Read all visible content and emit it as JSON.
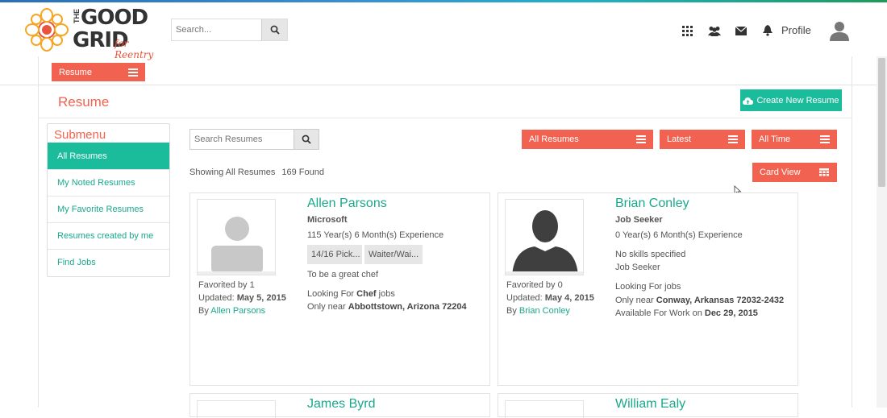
{
  "header": {
    "logo": {
      "line1": "GOOD",
      "line2": "GRID",
      "top_word": "THE",
      "sub": "for Reentry"
    },
    "search": {
      "placeholder": "Search..."
    },
    "nav_icons": [
      "apps-grid-icon",
      "users-icon",
      "envelope-icon",
      "bell-icon"
    ],
    "profile_label": "Profile"
  },
  "toolbar": {
    "resume_tab_label": "Resume"
  },
  "page": {
    "title": "Resume",
    "create_button_label": "Create New Resume"
  },
  "submenu": {
    "title": "Submenu",
    "items": [
      {
        "label": "All Resumes",
        "active": true
      },
      {
        "label": "My Noted Resumes",
        "active": false
      },
      {
        "label": "My Favorite Resumes",
        "active": false
      },
      {
        "label": "Resumes created by me",
        "active": false
      },
      {
        "label": "Find Jobs",
        "active": false
      }
    ]
  },
  "resumes_search": {
    "placeholder": "Search Resumes"
  },
  "filters": {
    "all": "All Resumes",
    "latest": "Latest",
    "time": "All Time",
    "view": "Card View"
  },
  "results": {
    "showing": "Showing All Resumes",
    "found": "169 Found"
  },
  "cards": [
    {
      "name": "Allen Parsons",
      "company": "Microsoft",
      "experience": "115 Year(s) 6 Month(s) Experience",
      "skills": [
        "14/16 Pick...",
        "Waiter/Wai..."
      ],
      "summary": "To be a great chef",
      "looking_prefix": "Looking For",
      "looking_value": "Chef",
      "looking_suffix": "jobs",
      "near_prefix": "Only near",
      "near_value": "Abbottstown, Arizona 72204",
      "favorited": "Favorited by 1",
      "updated_prefix": "Updated:",
      "updated_value": "May 5, 2015",
      "by_prefix": "By",
      "by_value": "Allen Parsons"
    },
    {
      "name": "Brian Conley",
      "company": "Job Seeker",
      "experience": "0 Year(s) 6 Month(s) Experience",
      "no_skills": "No skills specified",
      "summary": "Job Seeker",
      "looking_text": "Looking For jobs",
      "near_prefix": "Only near",
      "near_value": "Conway, Arkansas 72032-2432",
      "available_prefix": "Available For Work on",
      "available_value": "Dec 29, 2015",
      "favorited": "Favorited by 0",
      "updated_prefix": "Updated:",
      "updated_value": "May 4, 2015",
      "by_prefix": "By",
      "by_value": "Brian Conley"
    },
    {
      "name": "James Byrd"
    },
    {
      "name": "William Ealy"
    }
  ],
  "colors": {
    "accent_red": "#f26250",
    "accent_teal": "#1abc9c",
    "link_teal": "#1aa88d"
  }
}
